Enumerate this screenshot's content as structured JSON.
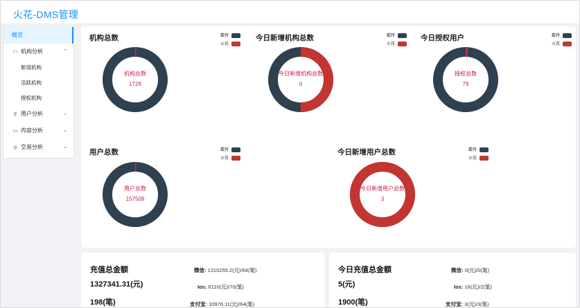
{
  "app": {
    "title": "火花-DMS管理"
  },
  "sidebar": {
    "overview": "概览",
    "org_analysis": "机构分析",
    "org_sub": [
      "新增机构",
      "活跃机构",
      "授权机构"
    ],
    "user_analysis": "用户分析",
    "content_analysis": "内容分析",
    "trade_analysis": "交易分析"
  },
  "legend": {
    "a": "戴特",
    "b": "火花"
  },
  "colors": {
    "dark": "#2f4050",
    "red": "#c23531",
    "accent": "#1890ff",
    "center_text": "#cc1a4a"
  },
  "donuts": [
    {
      "title": "机构总数",
      "center_label": "机构总数",
      "value": "1728",
      "red_fraction": 0.006
    },
    {
      "title": "今日新增机构总数",
      "center_label": "今日新增机构总数",
      "value": "0",
      "red_fraction": 0.5
    },
    {
      "title": "今日授权用户",
      "center_label": "授权总数",
      "value": "79",
      "red_fraction": 0.012
    },
    {
      "title": "用户总数",
      "center_label": "用户总数",
      "value": "157509",
      "red_fraction": 0.006
    },
    {
      "title": "今日新增用户总数",
      "center_label": "今日新增用户总数",
      "value": "3",
      "red_fraction": 1.0
    }
  ],
  "recharge_total": {
    "title": "充值总金额",
    "amount": "1327341.31(元)",
    "count": "198(笔)",
    "wechat_label": "微信:",
    "wechat_value": "1310255.2(元)/64(笔)",
    "ios_label": "Ios:",
    "ios_value": "6110(元)/70(笔)",
    "alipay_label": "支付宝:",
    "alipay_value": "10976.11(元)/64(笔)"
  },
  "recharge_today": {
    "title": "今日充值总金额",
    "amount": "5(元)",
    "count": "1900(笔)",
    "wechat_label": "微信:",
    "wechat_value": "0(元)/0(笔)",
    "ios_label": "Ios:",
    "ios_value": "16(元)/2(笔)",
    "alipay_label": "支付宝:",
    "alipay_value": "3(元)/3(笔)"
  }
}
